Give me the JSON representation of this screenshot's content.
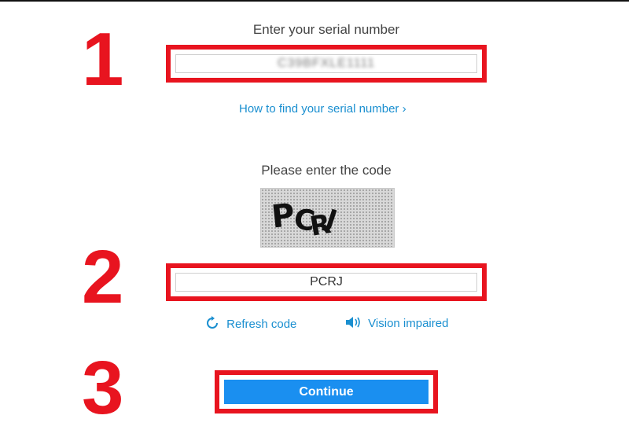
{
  "steps": [
    "1",
    "2",
    "3"
  ],
  "serial": {
    "label": "Enter your serial number",
    "value": "C39BFXLE1111",
    "help_link": "How to find your serial number ›"
  },
  "captcha": {
    "label": "Please enter the code",
    "image_text": "PCRJ",
    "value": "PCRJ",
    "refresh_label": "Refresh code",
    "vision_label": "Vision impaired"
  },
  "actions": {
    "continue_label": "Continue"
  },
  "colors": {
    "highlight": "#e8141f",
    "link": "#1a8fd0",
    "button": "#1a8ff0"
  },
  "icons": {
    "refresh": "refresh-icon",
    "speaker": "speaker-icon"
  }
}
